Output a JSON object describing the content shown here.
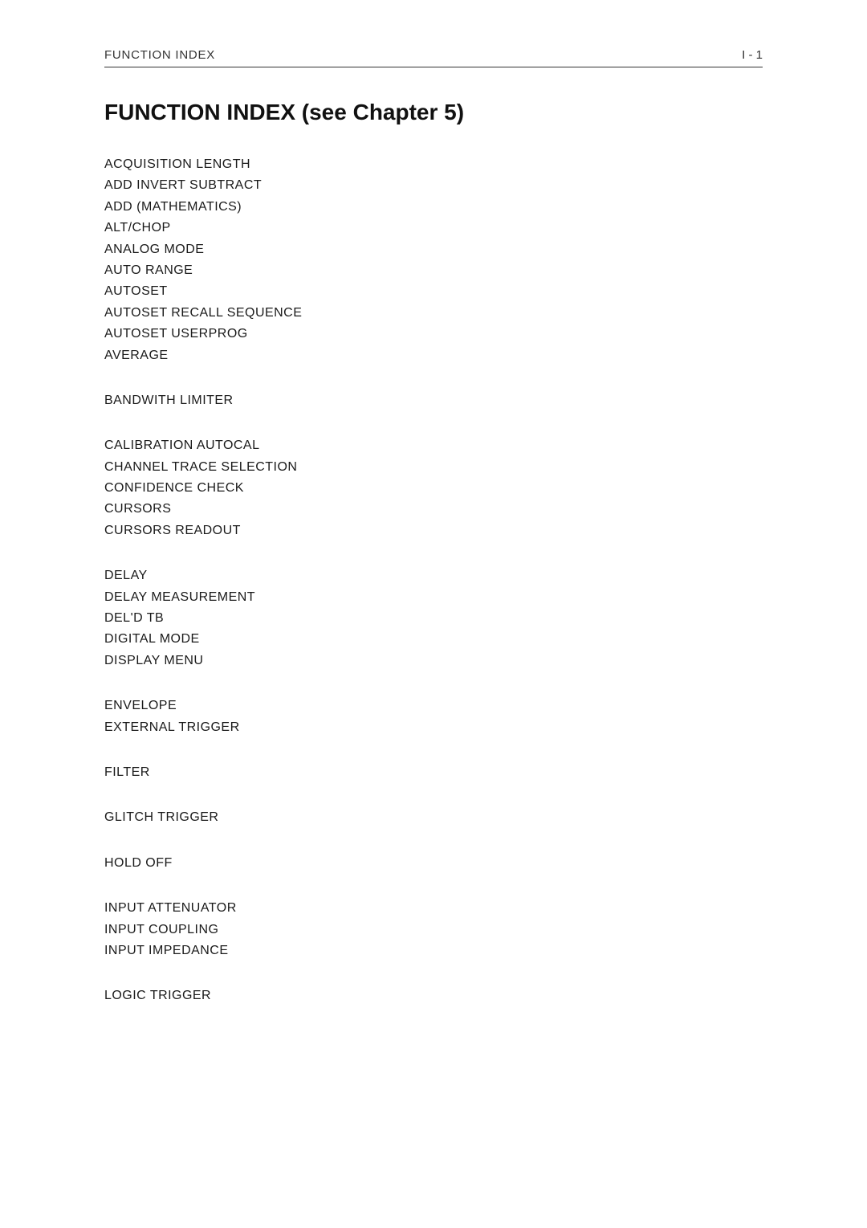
{
  "header": {
    "label": "FUNCTION INDEX",
    "page": "I - 1"
  },
  "title": "FUNCTION INDEX (see Chapter 5)",
  "sections": [
    {
      "id": "section-a",
      "entries": [
        "ACQUISITION LENGTH",
        "ADD INVERT SUBTRACT",
        "ADD (MATHEMATICS)",
        "ALT/CHOP",
        "ANALOG MODE",
        "AUTO RANGE",
        "AUTOSET",
        "AUTOSET RECALL SEQUENCE",
        "AUTOSET USERPROG",
        "AVERAGE"
      ]
    },
    {
      "id": "section-b",
      "entries": [
        "BANDWITH LIMITER"
      ]
    },
    {
      "id": "section-c",
      "entries": [
        "CALIBRATION AUTOCAL",
        "CHANNEL TRACE SELECTION",
        "CONFIDENCE CHECK",
        "CURSORS",
        "CURSORS READOUT"
      ]
    },
    {
      "id": "section-d",
      "entries": [
        "DELAY",
        "DELAY MEASUREMENT",
        "DEL'D TB",
        "DIGITAL MODE",
        "DISPLAY MENU"
      ]
    },
    {
      "id": "section-e",
      "entries": [
        "ENVELOPE",
        "EXTERNAL TRIGGER"
      ]
    },
    {
      "id": "section-f",
      "entries": [
        "FILTER"
      ]
    },
    {
      "id": "section-g",
      "entries": [
        "GLITCH TRIGGER"
      ]
    },
    {
      "id": "section-h",
      "entries": [
        "HOLD OFF"
      ]
    },
    {
      "id": "section-i",
      "entries": [
        "INPUT ATTENUATOR",
        "INPUT COUPLING",
        "INPUT IMPEDANCE"
      ]
    },
    {
      "id": "section-l",
      "entries": [
        "LOGIC TRIGGER"
      ]
    }
  ]
}
